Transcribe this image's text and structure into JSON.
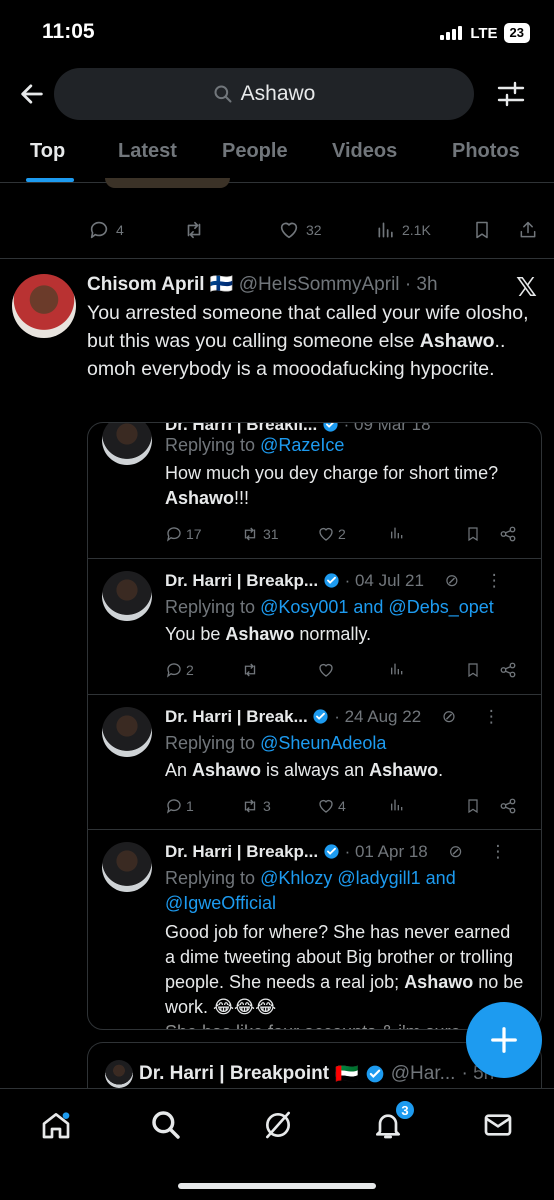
{
  "status_bar": {
    "time": "11:05",
    "network": "LTE",
    "battery": "23"
  },
  "header": {
    "search_query": "Ashawo"
  },
  "tabs": [
    {
      "label": "Top",
      "active": true
    },
    {
      "label": "Latest",
      "active": false
    },
    {
      "label": "People",
      "active": false
    },
    {
      "label": "Videos",
      "active": false
    },
    {
      "label": "Photos",
      "active": false
    }
  ],
  "prev_tweet_actions": {
    "replies": "4",
    "likes": "32",
    "views": "2.1K"
  },
  "tweet": {
    "author_name": "Chisom April",
    "flag": "🇫🇮",
    "handle": "@HeIsSommyApril",
    "time": "· 3h",
    "text_part1": "You arrested someone that called your wife olosho, but this was you calling someone else ",
    "text_bold": "Ashawo",
    "text_part2": ".. omoh everybody is a mooodafucking hypocrite."
  },
  "quoted": [
    {
      "author": "Dr. Harri | Breakii...",
      "date": "· 09 Mar 18",
      "replying_label": "Replying to ",
      "replying_to": "@RazeIce",
      "text_part1": "How much you dey charge for short time? ",
      "text_bold": "Ashawo",
      "text_part2": "!!!",
      "replies": "17",
      "retweets": "31",
      "likes": "2"
    },
    {
      "author": "Dr. Harri | Breakp...",
      "date": "· 04 Jul 21",
      "replying_label": "Replying to ",
      "replying_to": "@Kosy001 and @Debs_opet",
      "text_part1": "You be ",
      "text_bold": "Ashawo",
      "text_part2": " normally.",
      "replies": "2",
      "retweets": "",
      "likes": ""
    },
    {
      "author": "Dr. Harri | Break...",
      "date": "· 24 Aug 22",
      "replying_label": "Replying to ",
      "replying_to": "@SheunAdeola",
      "text_part1": "An ",
      "text_bold": "Ashawo",
      "text_part2": " is always an ",
      "text_bold2": "Ashawo",
      "text_part3": ".",
      "replies": "1",
      "retweets": "3",
      "likes": "4"
    },
    {
      "author": "Dr. Harri | Breakp...",
      "date": "· 01 Apr 18",
      "replying_label": "Replying to ",
      "replying_to": "@Khlozy @ladygill1 and @IgweOfficial",
      "text_part1": "Good job for where? She has never earned a dime tweeting about Big brother or trolling people. She needs a real job; ",
      "text_bold": "Ashawo",
      "text_part2": " no be work. 😂😂😂",
      "text_cutoff": "She has like four accounts & i'm sure"
    }
  ],
  "next_tweet": {
    "author": "Dr. Harri | Breakpoint",
    "flag": "🇦🇪",
    "handle": "@Har...",
    "time": "· 5h"
  },
  "nav": {
    "notifications_badge": "3"
  },
  "colors": {
    "accent": "#1d9bf0",
    "background": "#000000",
    "muted": "#71767b",
    "divider": "#2f3336"
  }
}
